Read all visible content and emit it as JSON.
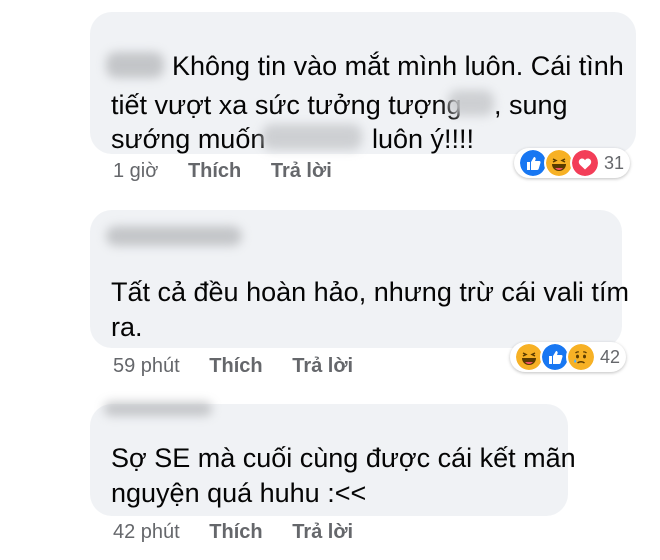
{
  "comments": [
    {
      "lines": [
        "Không tin vào mắt mình luôn. Cái tình",
        "tiết vượt xa sức tưởng tượng",
        ", sung",
        "sướng muốn",
        "luôn ý!!!!"
      ],
      "time": "1 giờ",
      "like_label": "Thích",
      "reply_label": "Trả lời",
      "reaction_icons": [
        "like-icon",
        "haha-icon",
        "love-icon"
      ],
      "reaction_count": "31"
    },
    {
      "lines": [
        "Tất cả đều hoàn hảo, nhưng trừ cái vali tím",
        "ra."
      ],
      "time": "59 phút",
      "like_label": "Thích",
      "reply_label": "Trả lời",
      "reaction_icons": [
        "haha-icon",
        "like-icon",
        "sad-icon"
      ],
      "reaction_count": "42"
    },
    {
      "lines": [
        "Sợ SE mà cuối cùng được cái kết mãn",
        "nguyện quá huhu :<<"
      ],
      "time": "42 phút",
      "like_label": "Thích",
      "reply_label": "Trả lời"
    }
  ],
  "colors": {
    "bubble": "#f0f2f5",
    "meta_text": "#65676b",
    "like_blue": "#1877f2",
    "love_red": "#f33e58",
    "emoji_yellow": "#f7b125"
  }
}
